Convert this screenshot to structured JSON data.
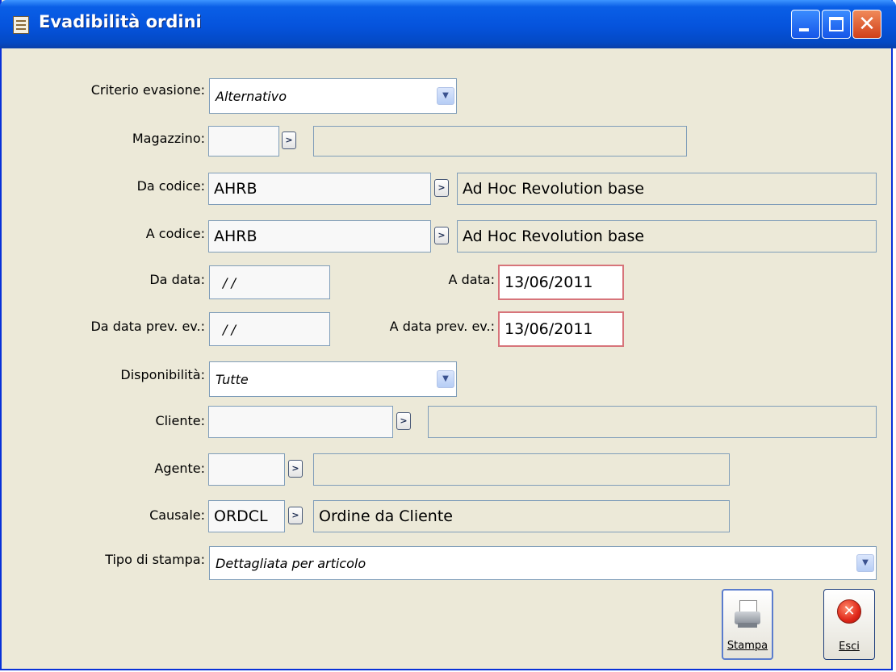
{
  "window": {
    "title": "Evadibilità ordini"
  },
  "form": {
    "criterio_label": "Criterio evasione:",
    "criterio_value": "Alternativo",
    "magazzino_label": "Magazzino:",
    "magazzino_code": "",
    "magazzino_desc": "",
    "da_codice_label": "Da codice:",
    "da_codice_code": "AHRB",
    "da_codice_desc": "Ad Hoc Revolution base",
    "a_codice_label": "A codice:",
    "a_codice_code": "AHRB",
    "a_codice_desc": "Ad Hoc Revolution base",
    "da_data_label": "Da data:",
    "da_data_value": "/ /",
    "a_data_label": "A data:",
    "a_data_value": "13/06/2011",
    "da_data_prev_label": "Da data prev. ev.:",
    "da_data_prev_value": "/ /",
    "a_data_prev_label": "A data prev. ev.:",
    "a_data_prev_value": "13/06/2011",
    "disponibilita_label": "Disponibilità:",
    "disponibilita_value": "Tutte",
    "cliente_label": "Cliente:",
    "cliente_code": "",
    "cliente_desc": "",
    "agente_label": "Agente:",
    "agente_code": "",
    "agente_desc": "",
    "causale_label": "Causale:",
    "causale_code": "ORDCL",
    "causale_desc": "Ordine da Cliente",
    "tipo_stampa_label": "Tipo di stampa:",
    "tipo_stampa_value": "Dettagliata per articolo"
  },
  "buttons": {
    "stampa": "Stampa",
    "esci": "Esci"
  }
}
